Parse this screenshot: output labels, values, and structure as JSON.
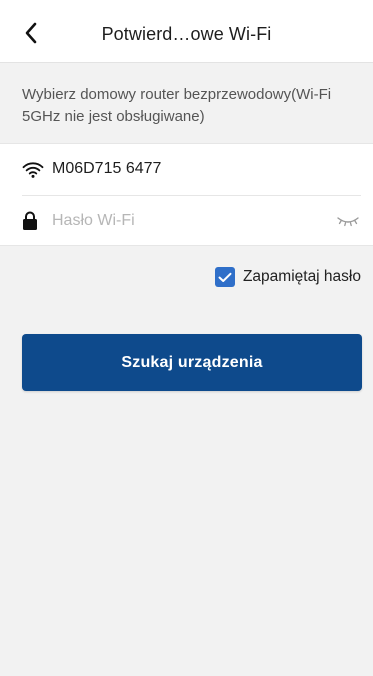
{
  "header": {
    "title": "Potwierd…owe Wi-Fi"
  },
  "instruction": {
    "text": "Wybierz domowy router bezprzewodowy(Wi-Fi 5GHz nie jest obsługiwane)"
  },
  "wifi": {
    "ssid": "M06D715 6477",
    "password_value": "",
    "password_placeholder": "Hasło Wi-Fi"
  },
  "remember": {
    "label": "Zapamiętaj hasło",
    "checked": true
  },
  "action": {
    "search_label": "Szukaj urządzenia"
  },
  "colors": {
    "primary_button": "#0e4a8c",
    "checkbox": "#2f6fc9",
    "background": "#f2f2f2"
  },
  "icons": [
    "back-icon",
    "wifi-icon",
    "lock-icon",
    "eye-closed-icon",
    "checkmark-icon"
  ]
}
